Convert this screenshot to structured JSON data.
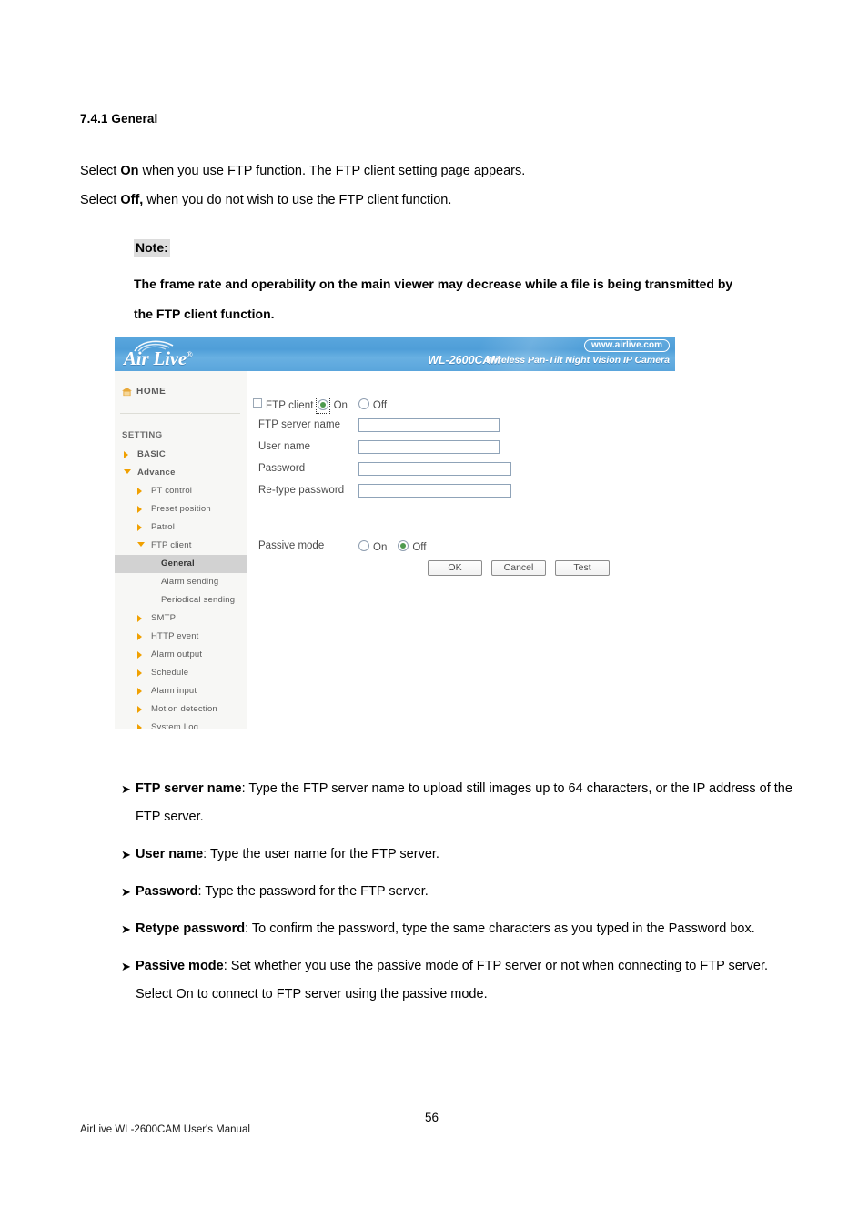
{
  "document": {
    "section_heading": "7.4.1 General",
    "paragraphs": [
      {
        "lead": "Select ",
        "bold": "On",
        "rest": " when you use FTP function. The FTP client setting page appears."
      },
      {
        "lead": "Select ",
        "bold": "Off,",
        "rest": " when you do not wish to use the FTP client function."
      }
    ],
    "note": {
      "label": "Note:",
      "body": "The frame rate and operability on the main viewer may decrease while a file is being transmitted by the FTP client function."
    }
  },
  "screenshot": {
    "banner": {
      "logo_text": "Air Live",
      "logo_registered": "®",
      "model": "WL-2600CAM",
      "tagline": "Wireless Pan-Tilt Night Vision IP Camera",
      "url": "www.airlive.com"
    },
    "sidebar": {
      "home_label": "HOME",
      "setting_label": "SETTING",
      "items": [
        {
          "label": "BASIC",
          "level": 0,
          "arrow": "right",
          "selected": false
        },
        {
          "label": "Advance",
          "level": 0,
          "arrow": "down",
          "selected": false
        },
        {
          "label": "PT control",
          "level": 1,
          "arrow": "right",
          "selected": false
        },
        {
          "label": "Preset position",
          "level": 1,
          "arrow": "right",
          "selected": false
        },
        {
          "label": "Patrol",
          "level": 1,
          "arrow": "right",
          "selected": false
        },
        {
          "label": "FTP client",
          "level": 1,
          "arrow": "down",
          "selected": false
        },
        {
          "label": "General",
          "level": 2,
          "arrow": "none",
          "selected": true
        },
        {
          "label": "Alarm sending",
          "level": 2,
          "arrow": "none",
          "selected": false
        },
        {
          "label": "Periodical sending",
          "level": 2,
          "arrow": "none",
          "selected": false
        },
        {
          "label": "SMTP",
          "level": 1,
          "arrow": "right",
          "selected": false
        },
        {
          "label": "HTTP event",
          "level": 1,
          "arrow": "right",
          "selected": false
        },
        {
          "label": "Alarm output",
          "level": 1,
          "arrow": "right",
          "selected": false
        },
        {
          "label": "Schedule",
          "level": 1,
          "arrow": "right",
          "selected": false
        },
        {
          "label": "Alarm input",
          "level": 1,
          "arrow": "right",
          "selected": false
        },
        {
          "label": "Motion detection",
          "level": 1,
          "arrow": "right",
          "selected": false
        },
        {
          "label": "System Log",
          "level": 1,
          "arrow": "right",
          "selected": false
        }
      ]
    },
    "form": {
      "ftp_client_label": "FTP client",
      "ftp_client_on": "On",
      "ftp_client_off": "Off",
      "ftp_client_value": "On",
      "fields": [
        {
          "label": "FTP server name",
          "value": ""
        },
        {
          "label": "User name",
          "value": ""
        },
        {
          "label": "Password",
          "value": ""
        },
        {
          "label": "Re-type password",
          "value": ""
        }
      ],
      "passive_mode_label": "Passive mode",
      "passive_mode_on": "On",
      "passive_mode_off": "Off",
      "passive_mode_value": "Off",
      "buttons": {
        "ok": "OK",
        "cancel": "Cancel",
        "test": "Test"
      }
    }
  },
  "bullets": [
    {
      "marker": "➤",
      "term": "FTP server name",
      "text": ": Type the FTP server name to upload still images up to 64 characters, or the IP address of the FTP server."
    },
    {
      "marker": "➤",
      "term": "User name",
      "text": ": Type the user name for the FTP server."
    },
    {
      "marker": "➤",
      "term": "Password",
      "text": ": Type the password for the FTP server."
    },
    {
      "marker": "➤",
      "term": "Retype password",
      "text": ": To confirm the password, type the same characters as you typed in the Password box."
    },
    {
      "marker": "➤",
      "term": "Passive mode",
      "text": ": Set whether you use the passive mode of FTP server or not when connecting to FTP server. Select On to connect to FTP server using the passive mode."
    }
  ],
  "footer": {
    "manual": "AirLive WL-2600CAM User's Manual",
    "page_number": "56"
  },
  "colors": {
    "banner_blue": "#4f9ed8",
    "sidebar_bg": "#f7f7f5",
    "arrow_orange": "#f0a000",
    "selected_row": "#d2d2d2",
    "radio_dot_green": "#4f9a4f",
    "note_highlight": "#dcdcdc"
  }
}
